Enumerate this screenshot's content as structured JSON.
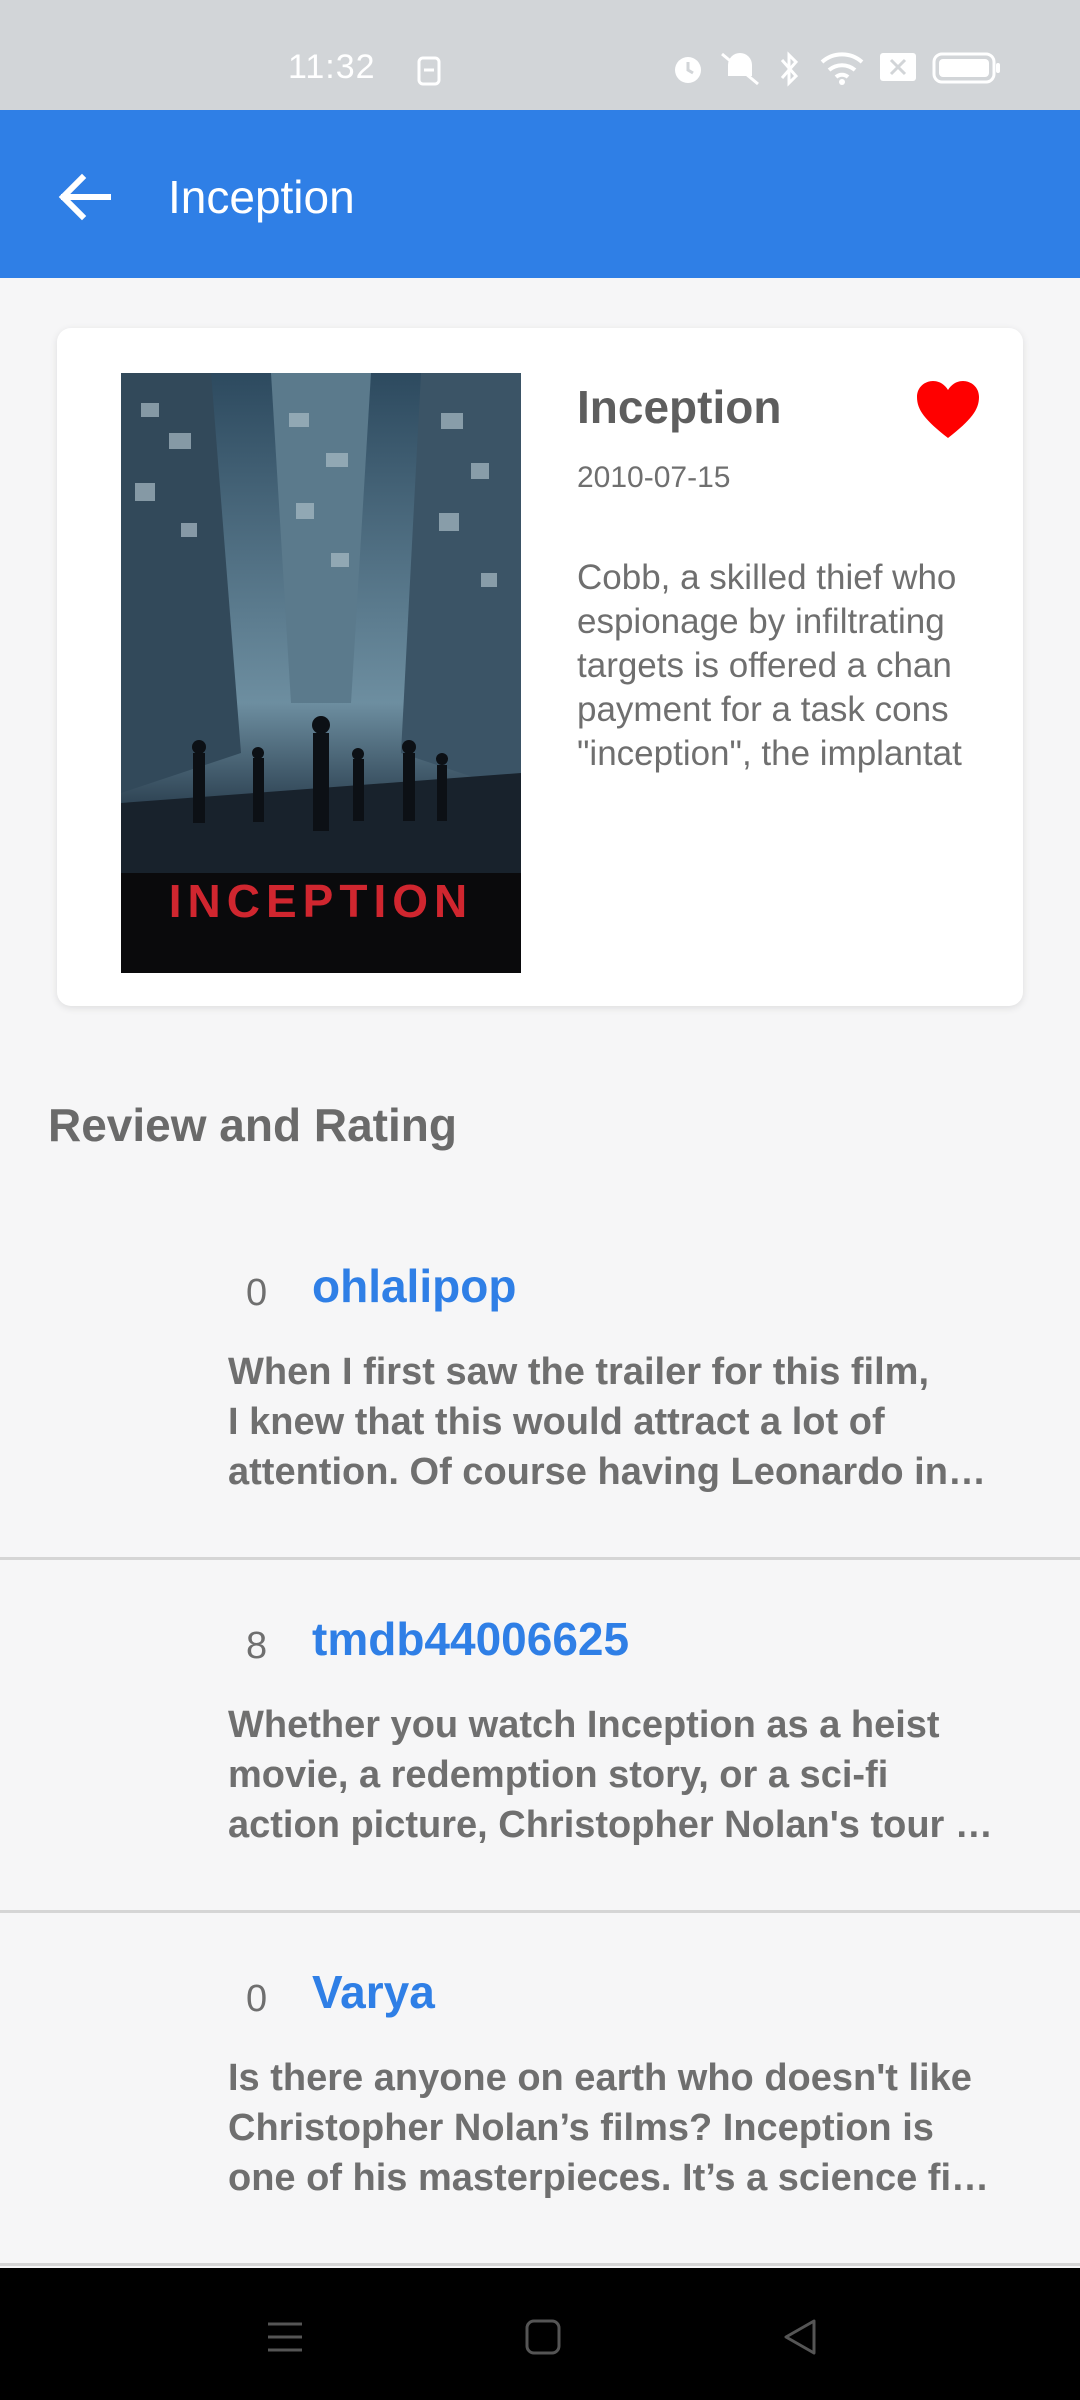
{
  "status_bar": {
    "time": "11:32",
    "icons": [
      "sim-icon",
      "alarm-icon",
      "mute-icon",
      "bluetooth-icon",
      "wifi-icon",
      "no-signal-icon",
      "battery-icon"
    ]
  },
  "app_bar": {
    "back_icon": "arrow-left-icon",
    "title": "Inception",
    "color": "#2f7fe6"
  },
  "movie": {
    "poster_text": "INCEPTION",
    "title": "Inception",
    "release_date": "2010-07-15",
    "favorite": true,
    "favorite_color": "#ff0000",
    "overview_lines": [
      "Cobb, a skilled thief who",
      "espionage by infiltrating",
      "targets is offered a chan",
      "payment for a task cons",
      "\"inception\", the implantat"
    ]
  },
  "section_title": "Review and Rating",
  "reviews": [
    {
      "count": "0",
      "author": "ohlalipop",
      "lines": [
        "When I first saw the trailer for this film,",
        "I knew that this would attract a lot of",
        "attention. Of course having Leonardo in…"
      ]
    },
    {
      "count": "8",
      "author": "tmdb44006625",
      "lines": [
        "Whether you watch Inception as a heist",
        "movie, a redemption story, or a sci-fi",
        "action picture, Christopher Nolan's tour …"
      ]
    },
    {
      "count": "0",
      "author": "Varya",
      "lines": [
        "Is there anyone on earth who doesn't like",
        "Christopher Nolan’s films? Inception is",
        "one of his masterpieces. It’s a science fi…"
      ]
    }
  ],
  "nav_bar": {
    "icons": [
      "menu-icon",
      "home-icon",
      "back-triangle-icon"
    ]
  }
}
